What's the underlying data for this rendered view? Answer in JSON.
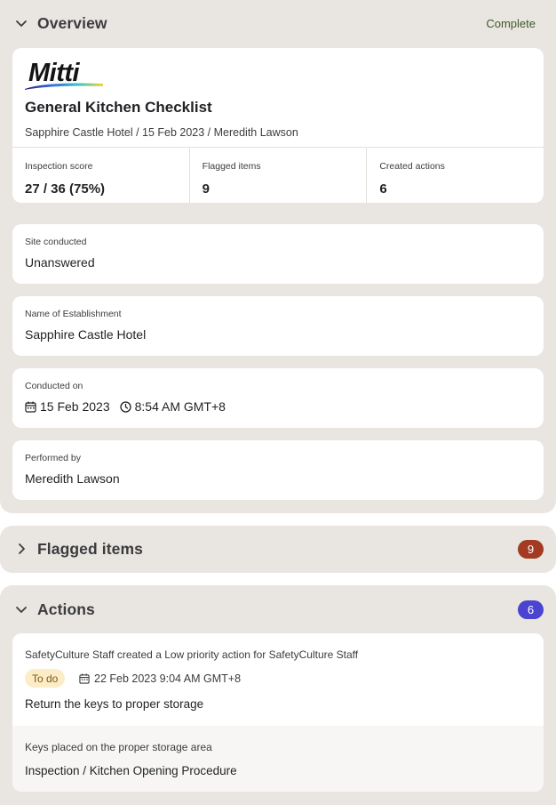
{
  "overview": {
    "title": "Overview",
    "status": "Complete",
    "report": {
      "logo_text": "Mitti",
      "title": "General Kitchen Checklist",
      "subtitle": "Sapphire Castle Hotel / 15 Feb 2023 / Meredith Lawson"
    },
    "stats": [
      {
        "label": "Inspection score",
        "value": "27 / 36 (75%)"
      },
      {
        "label": "Flagged items",
        "value": "9"
      },
      {
        "label": "Created actions",
        "value": "6"
      }
    ],
    "fields": {
      "site": {
        "label": "Site conducted",
        "value": "Unanswered"
      },
      "establishment": {
        "label": "Name of Establishment",
        "value": "Sapphire Castle Hotel"
      },
      "conducted": {
        "label": "Conducted on",
        "date": "15 Feb 2023",
        "time": "8:54 AM GMT+8"
      },
      "performed": {
        "label": "Performed by",
        "value": "Meredith Lawson"
      }
    }
  },
  "flagged": {
    "title": "Flagged items",
    "count": "9",
    "badge_color": "#a33a22"
  },
  "actions": {
    "title": "Actions",
    "count": "6",
    "badge_color": "#4a44d0",
    "item": {
      "description": "SafetyCulture Staff created a Low priority action for SafetyCulture Staff",
      "status": "To do",
      "due": "22 Feb 2023 9:04 AM GMT+8",
      "title": "Return the keys to proper storage",
      "note": "Keys placed on the proper storage area",
      "path": "Inspection / Kitchen Opening Procedure"
    }
  }
}
